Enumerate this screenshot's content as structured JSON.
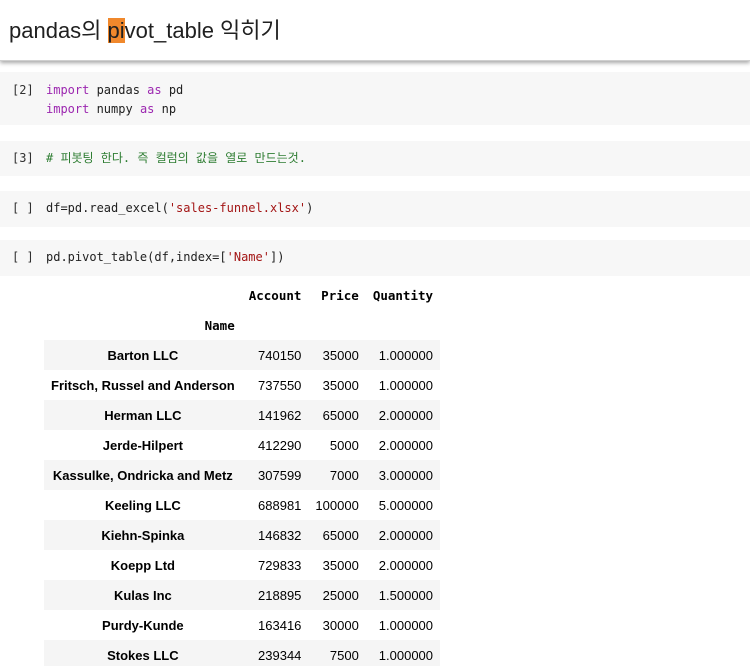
{
  "title": {
    "before": "pandas의 ",
    "highlight": "pi",
    "after": "vot_table 익히기"
  },
  "cells": {
    "imports": {
      "prompt": "[2]",
      "line1_kw1": "import",
      "line1_mod": " pandas ",
      "line1_kw2": "as",
      "line1_alias": " pd",
      "line2_kw1": "import",
      "line2_mod": " numpy ",
      "line2_kw2": "as",
      "line2_alias": " np"
    },
    "comment": {
      "prompt": "[3]",
      "text": "# 피봇팅 한다. 즉 컬럼의 값을 열로 만드는것."
    },
    "read": {
      "prompt": "[ ]",
      "before": "df=pd.read_excel(",
      "string": "'sales-funnel.xlsx'",
      "after": ")"
    },
    "pivot": {
      "prompt": "[ ]",
      "before": "pd.pivot_table(df,index=[",
      "string": "'Name'",
      "after": "])"
    }
  },
  "table": {
    "columns": [
      "Account",
      "Price",
      "Quantity"
    ],
    "index_name": "Name",
    "rows": [
      {
        "name": "Barton LLC",
        "account": "740150",
        "price": "35000",
        "quantity": "1.000000"
      },
      {
        "name": "Fritsch, Russel and Anderson",
        "account": "737550",
        "price": "35000",
        "quantity": "1.000000"
      },
      {
        "name": "Herman LLC",
        "account": "141962",
        "price": "65000",
        "quantity": "2.000000"
      },
      {
        "name": "Jerde-Hilpert",
        "account": "412290",
        "price": "5000",
        "quantity": "2.000000"
      },
      {
        "name": "Kassulke, Ondricka and Metz",
        "account": "307599",
        "price": "7000",
        "quantity": "3.000000"
      },
      {
        "name": "Keeling LLC",
        "account": "688981",
        "price": "100000",
        "quantity": "5.000000"
      },
      {
        "name": "Kiehn-Spinka",
        "account": "146832",
        "price": "65000",
        "quantity": "2.000000"
      },
      {
        "name": "Koepp Ltd",
        "account": "729833",
        "price": "35000",
        "quantity": "2.000000"
      },
      {
        "name": "Kulas Inc",
        "account": "218895",
        "price": "25000",
        "quantity": "1.500000"
      },
      {
        "name": "Purdy-Kunde",
        "account": "163416",
        "price": "30000",
        "quantity": "1.000000"
      },
      {
        "name": "Stokes LLC",
        "account": "239344",
        "price": "7500",
        "quantity": "1.000000"
      }
    ]
  },
  "colors": {
    "highlight": "#f0882c",
    "keyword": "#9c27b0",
    "comment": "#2e7d32",
    "string": "#a31515",
    "cell_bg": "#f7f7f7"
  }
}
